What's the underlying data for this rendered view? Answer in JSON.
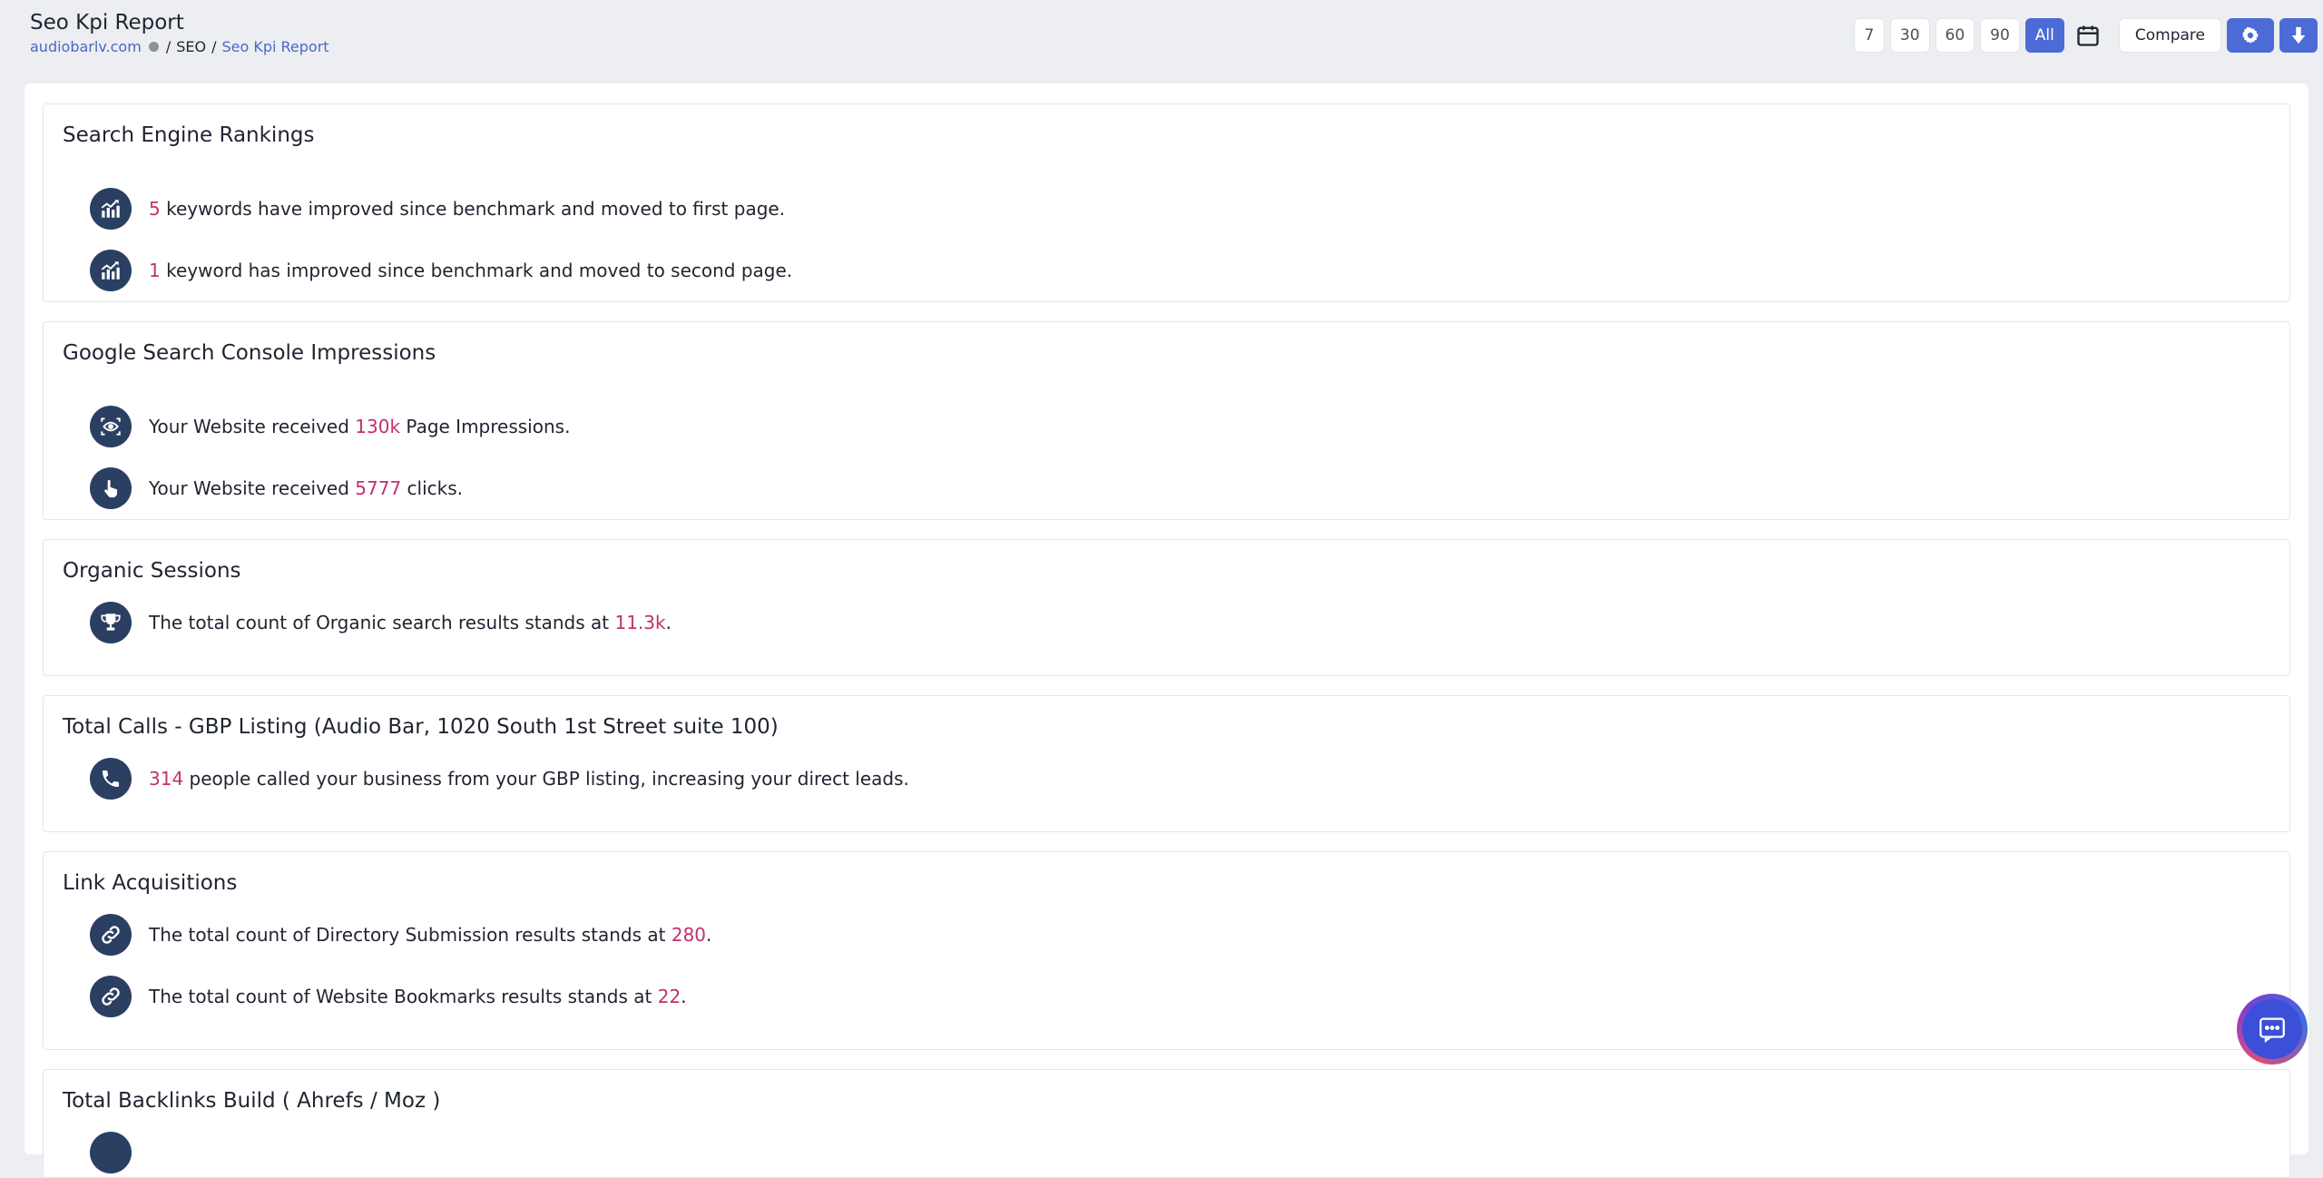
{
  "header": {
    "title": "Seo Kpi Report",
    "breadcrumb": {
      "site": "audiobarlv.com",
      "section": "SEO",
      "current": "Seo Kpi Report",
      "sep": "/"
    }
  },
  "toolbar": {
    "ranges": [
      "7",
      "30",
      "60",
      "90",
      "All"
    ],
    "active_range": "All",
    "compare_label": "Compare"
  },
  "cards": [
    {
      "title": "Search Engine Rankings",
      "rows": [
        {
          "icon": "chart-trend-icon",
          "pre": "",
          "num": "5",
          "post": " keywords have improved since benchmark and moved to first page."
        },
        {
          "icon": "chart-trend-icon",
          "pre": "",
          "num": "1",
          "post": " keyword has improved since benchmark and moved to second page."
        }
      ]
    },
    {
      "title": "Google Search Console Impressions",
      "rows": [
        {
          "icon": "eye-scan-icon",
          "pre": "Your Website received ",
          "num": "130k",
          "post": " Page Impressions."
        },
        {
          "icon": "hand-pointer-icon",
          "pre": "Your Website received ",
          "num": "5777",
          "post": " clicks."
        }
      ]
    },
    {
      "title": "Organic Sessions",
      "rows": [
        {
          "icon": "trophy-icon",
          "pre": "The total count of Organic search results stands at ",
          "num": "11.3k",
          "post": "."
        }
      ]
    },
    {
      "title": "Total Calls - GBP Listing (Audio Bar, 1020 South 1st Street suite 100)",
      "rows": [
        {
          "icon": "phone-icon",
          "pre": "",
          "num": "314",
          "post": " people called your business from your GBP listing, increasing your direct leads."
        }
      ]
    },
    {
      "title": "Link Acquisitions",
      "rows": [
        {
          "icon": "link-icon",
          "pre": "The total count of Directory Submission results stands at ",
          "num": "280",
          "post": "."
        },
        {
          "icon": "link-icon",
          "pre": "The total count of Website Bookmarks results stands at ",
          "num": "22",
          "post": "."
        }
      ]
    },
    {
      "title": "Total Backlinks Build ( Ahrefs / Moz )",
      "rows": []
    }
  ],
  "colors": {
    "accent": "#4d6bd6",
    "highlight": "#c2306f",
    "icon_bg": "#2b3f63"
  }
}
